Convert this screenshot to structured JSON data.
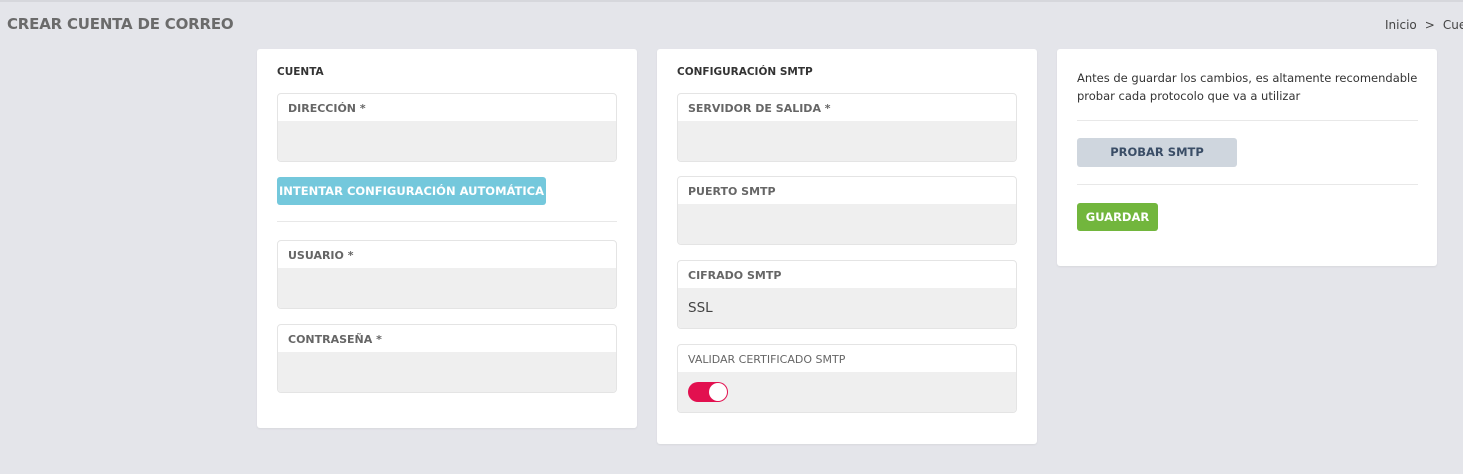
{
  "header": {
    "title": "CREAR CUENTA DE CORREO",
    "breadcrumb": [
      "Inicio",
      "Cuer"
    ],
    "breadcrumb_separator": ">"
  },
  "account_card": {
    "title": "CUENTA",
    "address": {
      "label": "DIRECCIÓN *",
      "value": ""
    },
    "auto_config_button": "INTENTAR CONFIGURACIÓN AUTOMÁTICA",
    "user": {
      "label": "USUARIO *",
      "value": ""
    },
    "password": {
      "label": "CONTRASEÑA *",
      "value": ""
    }
  },
  "smtp_card": {
    "title": "CONFIGURACIÓN SMTP",
    "server": {
      "label": "SERVIDOR DE SALIDA *",
      "value": ""
    },
    "port": {
      "label": "PUERTO SMTP",
      "value": ""
    },
    "encryption": {
      "label": "CIFRADO SMTP",
      "value": "SSL"
    },
    "validate_cert": {
      "label": "VALIDAR CERTIFICADO SMTP",
      "enabled": true
    }
  },
  "actions_card": {
    "note": "Antes de guardar los cambios, es altamente recomendable probar cada protocolo que va a utilizar",
    "test_button": "PROBAR SMTP",
    "save_button": "GUARDAR"
  },
  "colors": {
    "background": "#e4e5ea",
    "auto_config_button": "#74c8dc",
    "toggle_on": "#e2104f",
    "test_button": "#cfd6de",
    "save_button": "#72b63d"
  }
}
